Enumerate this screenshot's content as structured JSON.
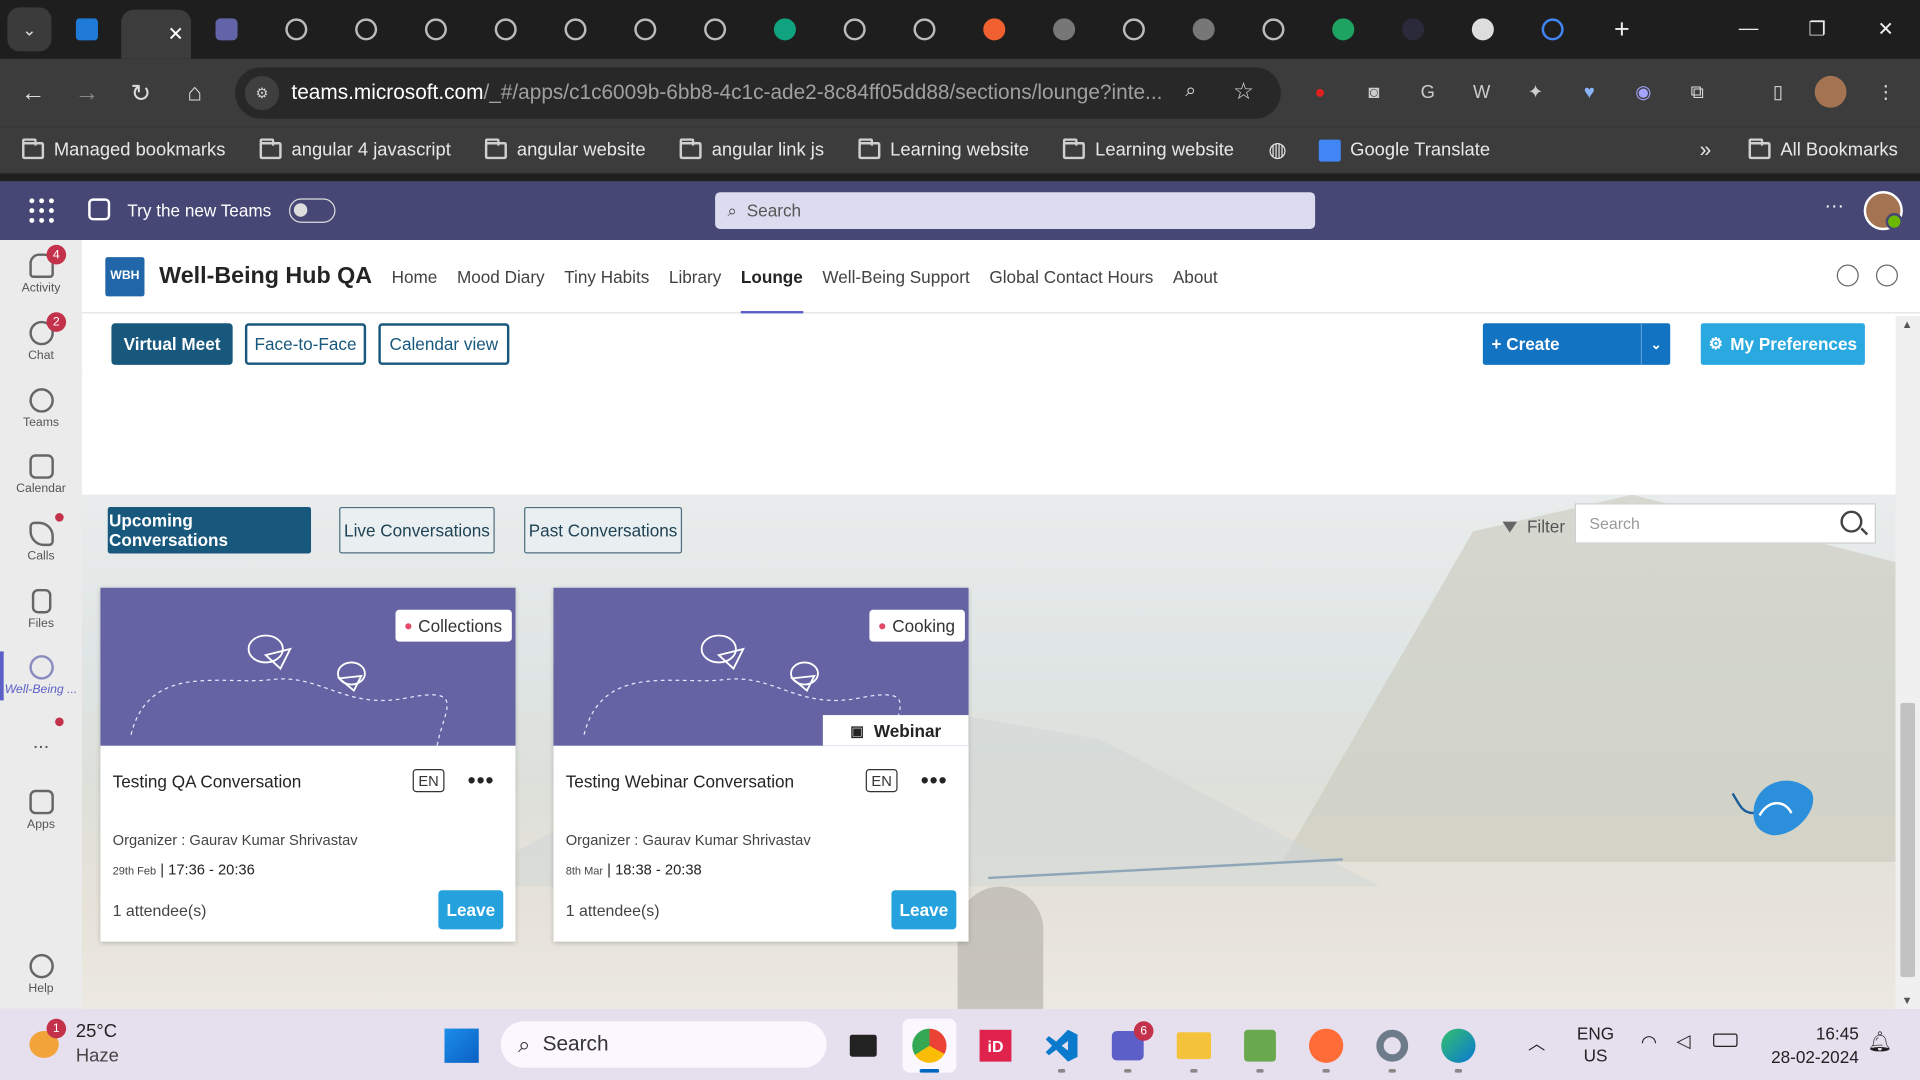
{
  "browser": {
    "url_host": "teams.microsoft.com",
    "url_path": "/_#/apps/c1c6009b-6bb8-4c1c-ade2-8c84ff05dd88/sections/lounge?inte...",
    "bookmarks": [
      "Managed bookmarks",
      "angular 4 javascript",
      "angular website",
      "angular link js",
      "Learning website",
      "Learning website",
      "Google Translate"
    ],
    "all_bookmarks": "All Bookmarks"
  },
  "teams": {
    "try_new": "Try the new Teams",
    "search_placeholder": "Search",
    "rail": [
      {
        "label": "Activity",
        "badge": "4"
      },
      {
        "label": "Chat",
        "badge": "2"
      },
      {
        "label": "Teams"
      },
      {
        "label": "Calendar"
      },
      {
        "label": "Calls"
      },
      {
        "label": "Files"
      },
      {
        "label": "Well-Being ..."
      },
      {
        "label": "..."
      },
      {
        "label": "Apps"
      },
      {
        "label": "Help"
      }
    ]
  },
  "app": {
    "logo": "WBH",
    "title": "Well-Being Hub QA",
    "nav": [
      "Home",
      "Mood Diary",
      "Tiny Habits",
      "Library",
      "Lounge",
      "Well-Being Support",
      "Global Contact Hours",
      "About"
    ],
    "active_nav": "Lounge",
    "mode_buttons": [
      "Virtual Meet",
      "Face-to-Face",
      "Calendar view"
    ],
    "create_label": "+ Create",
    "preferences_label": "My Preferences",
    "conversation_tabs": [
      "Upcoming Conversations",
      "Live Conversations",
      "Past Conversations"
    ],
    "filter_label": "Filter",
    "search_placeholder": "Search",
    "cards": [
      {
        "category": "Collections",
        "title": "Testing QA Conversation",
        "lang": "EN",
        "more": "•••",
        "organizer": "Organizer : Gaurav Kumar Shrivastav",
        "date": "29th Feb",
        "time": "| 17:36 - 20:36",
        "attendees": "1 attendee(s)",
        "action": "Leave",
        "webinar": ""
      },
      {
        "category": "Cooking",
        "title": "Testing Webinar Conversation",
        "lang": "EN",
        "more": "•••",
        "organizer": "Organizer : Gaurav Kumar Shrivastav",
        "date": "8th Mar",
        "time": "| 18:38 - 20:38",
        "attendees": "1 attendee(s)",
        "action": "Leave",
        "webinar": "Webinar"
      }
    ]
  },
  "taskbar": {
    "weather_temp": "25°C",
    "weather_desc": "Haze",
    "weather_badge": "1",
    "search_label": "Search",
    "teams_badge": "6",
    "lang_1": "ENG",
    "lang_2": "US",
    "time": "16:45",
    "date": "28-02-2024"
  }
}
